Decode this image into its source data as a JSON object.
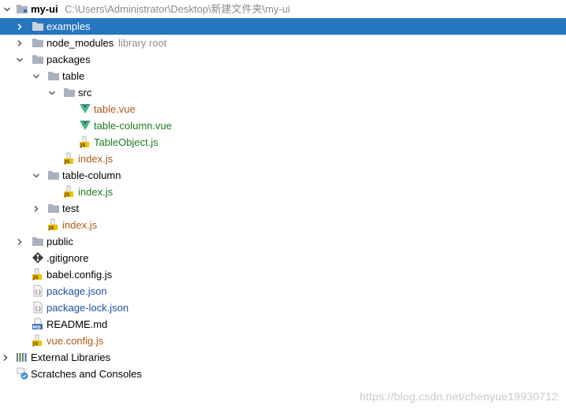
{
  "project": {
    "name": "my-ui",
    "path": "C:\\Users\\Administrator\\Desktop\\新建文件夹\\my-ui"
  },
  "tree": {
    "examples": "examples",
    "node_modules": "node_modules",
    "node_modules_hint": "library root",
    "packages": "packages",
    "table": "table",
    "src": "src",
    "table_vue": "table.vue",
    "table_column_vue": "table-column.vue",
    "table_object_js": "TableObject.js",
    "table_index_js": "index.js",
    "table_column": "table-column",
    "table_column_index_js": "index.js",
    "test": "test",
    "packages_index_js": "index.js",
    "public": "public",
    "gitignore": ".gitignore",
    "babel_config": "babel.config.js",
    "package_json": "package.json",
    "package_lock": "package-lock.json",
    "readme": "README.md",
    "vue_config": "vue.config.js",
    "external_libraries": "External Libraries",
    "scratches": "Scratches and Consoles"
  },
  "watermark": "https://blog.csdn.net/chenyue19930712",
  "colors": {
    "selection": "#2675bf",
    "folder": "#a9b1bd",
    "vue": "#41b883",
    "text_green": "#1e7b1e",
    "text_orange": "#b05a17",
    "text_blue": "#1f4fa3"
  }
}
